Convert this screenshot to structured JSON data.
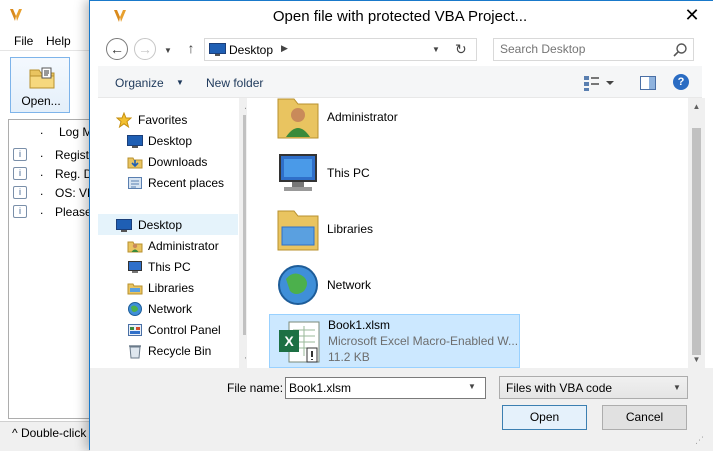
{
  "background_app": {
    "menu": [
      "File",
      "Help"
    ],
    "toolbar_open_label": "Open...",
    "log_rows": [
      {
        "marker": ".",
        "text": "Log M",
        "has_icon": false
      },
      {
        "marker": ".",
        "text": "Regist",
        "has_icon": true
      },
      {
        "marker": ".",
        "text": "Reg. D",
        "has_icon": true
      },
      {
        "marker": ".",
        "text": "OS: VM",
        "has_icon": true
      },
      {
        "marker": ".",
        "text": "Please",
        "has_icon": true
      }
    ],
    "status_text": "^ Double-click"
  },
  "dialog": {
    "title": "Open file with protected VBA Project...",
    "close_glyph": "✕",
    "address": {
      "location": "Desktop"
    },
    "search": {
      "placeholder": "Search Desktop"
    },
    "commands": {
      "organize": "Organize",
      "new_folder": "New folder",
      "help_glyph": "?"
    },
    "nav_pane": {
      "items": [
        {
          "label": "Favorites",
          "icon": "star-icon",
          "indent": 1
        },
        {
          "label": "Desktop",
          "icon": "desktop-icon",
          "indent": 2
        },
        {
          "label": "Downloads",
          "icon": "downloads-icon",
          "indent": 2
        },
        {
          "label": "Recent places",
          "icon": "recent-places-icon",
          "indent": 2
        },
        {
          "label": "Desktop",
          "icon": "desktop-icon",
          "indent": 1,
          "selected": true
        },
        {
          "label": "Administrator",
          "icon": "user-folder-icon",
          "indent": 2
        },
        {
          "label": "This PC",
          "icon": "computer-icon",
          "indent": 2
        },
        {
          "label": "Libraries",
          "icon": "libraries-icon",
          "indent": 2
        },
        {
          "label": "Network",
          "icon": "network-icon",
          "indent": 2
        },
        {
          "label": "Control Panel",
          "icon": "control-panel-icon",
          "indent": 2
        },
        {
          "label": "Recycle Bin",
          "icon": "recycle-bin-icon",
          "indent": 2
        }
      ]
    },
    "files": [
      {
        "name": "Administrator",
        "icon": "user-folder-icon",
        "lines": []
      },
      {
        "name": "This PC",
        "icon": "computer-icon",
        "lines": []
      },
      {
        "name": "Libraries",
        "icon": "libraries-icon",
        "lines": []
      },
      {
        "name": "Network",
        "icon": "network-icon",
        "lines": []
      },
      {
        "name": "Book1.xlsm",
        "icon": "excel-file-icon",
        "selected": true,
        "lines": [
          "Microsoft Excel Macro-Enabled W...",
          "11.2 KB"
        ]
      }
    ],
    "file_name_label": "File name:",
    "file_name_value": "Book1.xlsm",
    "file_type_value": "Files with VBA code",
    "open_label": "Open",
    "cancel_label": "Cancel"
  },
  "colors": {
    "accent": "#1979ca",
    "selection": "#cce8ff",
    "nav_selection": "#e5f3fb"
  }
}
